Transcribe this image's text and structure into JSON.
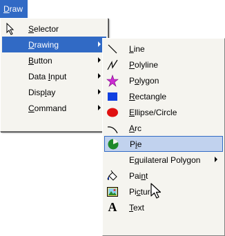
{
  "menubar": {
    "draw_label": "Draw"
  },
  "draw_menu": {
    "items": [
      {
        "label": "Selector",
        "icon": "selector-arrow-icon",
        "submenu": false
      },
      {
        "label": "Drawing",
        "submenu": true,
        "highlighted": true
      },
      {
        "label": "Button",
        "submenu": true
      },
      {
        "label": "Data Input",
        "submenu": true
      },
      {
        "label": "Display",
        "submenu": true
      },
      {
        "label": "Command",
        "submenu": true
      }
    ]
  },
  "drawing_submenu": {
    "items": [
      {
        "label": "Line",
        "icon": "line-icon"
      },
      {
        "label": "Polyline",
        "icon": "polyline-icon"
      },
      {
        "label": "Polygon",
        "icon": "polygon-star-icon"
      },
      {
        "label": "Rectangle",
        "icon": "rectangle-icon"
      },
      {
        "label": "Ellipse/Circle",
        "icon": "ellipse-icon"
      },
      {
        "label": "Arc",
        "icon": "arc-icon"
      },
      {
        "label": "Pie",
        "icon": "pie-icon",
        "hovered": true
      },
      {
        "label": "Equilateral Polygon",
        "submenu": true
      },
      {
        "label": "Paint",
        "icon": "paint-bucket-icon"
      },
      {
        "label": "Picture",
        "icon": "picture-icon"
      },
      {
        "label": "Text",
        "icon": "text-a-icon"
      }
    ]
  },
  "colors": {
    "highlight": "#316ac5",
    "hover_bg": "#c1d2ee",
    "menu_bg": "#f5f4ef",
    "polygon_magenta": "#cc2ad2",
    "rectangle_blue": "#1040e0",
    "ellipse_red": "#e01010",
    "pie_green": "#1e8a2a"
  }
}
